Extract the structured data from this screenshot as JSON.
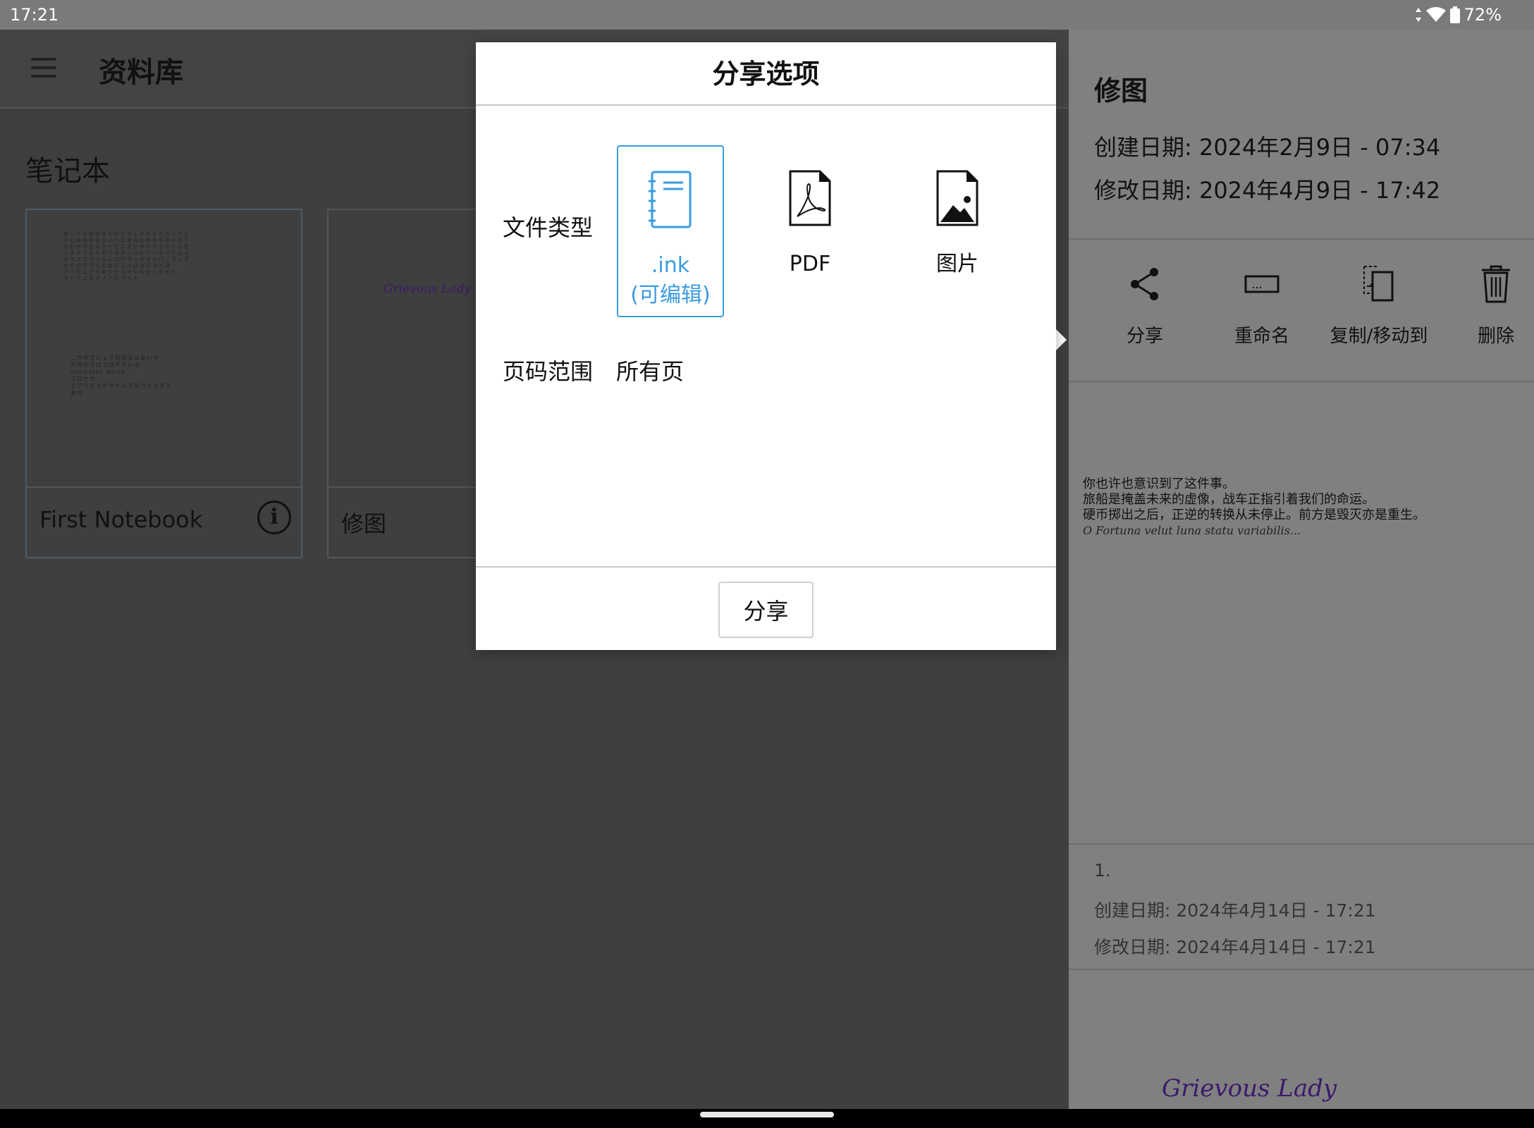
{
  "status": {
    "time": "17:21",
    "battery": "72%"
  },
  "app": {
    "title": "资料库",
    "section": "笔记本",
    "notebooks": [
      {
        "name": "First Notebook",
        "thumb_lines": [
          "このせでにょりお前なはあいわ",
          "不向なうはでは不でいる",
          "antipathy world",
          "ブロセカ",
          "ヒアリビマギサからすほうそさずて",
          "あれ"
        ]
      },
      {
        "name": "修图",
        "thumb_text": "Grievous Lady"
      }
    ]
  },
  "panel": {
    "title": "修图",
    "created": "创建日期: 2024年2月9日 - 07:34",
    "modified": "修改日期: 2024年4月9日 - 17:42",
    "actions": [
      {
        "label": "分享",
        "icon": "share-icon"
      },
      {
        "label": "重命名",
        "icon": "rename-icon"
      },
      {
        "label": "复制/移动到",
        "icon": "copy-move-icon"
      },
      {
        "label": "删除",
        "icon": "trash-icon"
      }
    ],
    "preview_lines": [
      "你也许也意识到了这件事。",
      "旅船是掩盖未来的虚像，战车正指引着我们的命运。",
      "硬币掷出之后，正逆的转换从未停止。前方是毁灭亦是重生。",
      "O Fortuna velut luna statu variabilis..."
    ],
    "page": {
      "number": "1.",
      "created": "创建日期: 2024年4月14日 - 17:21",
      "modified": "修改日期: 2024年4月14日 - 17:21"
    },
    "preview2_text": "Grievous Lady"
  },
  "dialog": {
    "title": "分享选项",
    "file_type_label": "文件类型",
    "options": [
      {
        "label_line1": ".ink",
        "label_line2": "(可编辑)",
        "icon": "notebook-icon",
        "selected": true
      },
      {
        "label_line1": "PDF",
        "label_line2": "",
        "icon": "pdf-icon",
        "selected": false
      },
      {
        "label_line1": "图片",
        "label_line2": "",
        "icon": "image-icon",
        "selected": false
      }
    ],
    "page_range_label": "页码范围",
    "page_range_value": "所有页",
    "share_button": "分享"
  },
  "colors": {
    "accent": "#3b9be0",
    "dim_background": "#3f3f3f",
    "panel_dim": "#808080"
  }
}
